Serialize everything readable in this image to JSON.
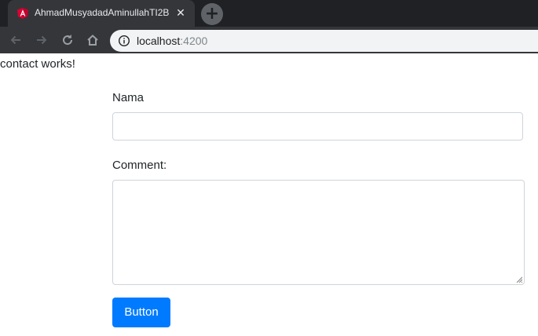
{
  "browser": {
    "tab": {
      "title": "AhmadMusyadadAminullahTI2B",
      "close_glyph": "✕",
      "favicon": "angular-icon"
    },
    "new_tab_glyph": "+",
    "url_host": "localhost",
    "url_port": ":4200",
    "colors": {
      "tabstrip": "#202124",
      "toolbar": "#35363a",
      "omnibox": "#f1f3f4"
    }
  },
  "page": {
    "component_text": "contact works!",
    "form": {
      "name_label": "Nama",
      "name_value": "",
      "comment_label": "Comment:",
      "comment_value": "",
      "button_label": "Button"
    },
    "colors": {
      "button": "#007bff",
      "text": "#212529",
      "border": "#ced4da"
    }
  }
}
